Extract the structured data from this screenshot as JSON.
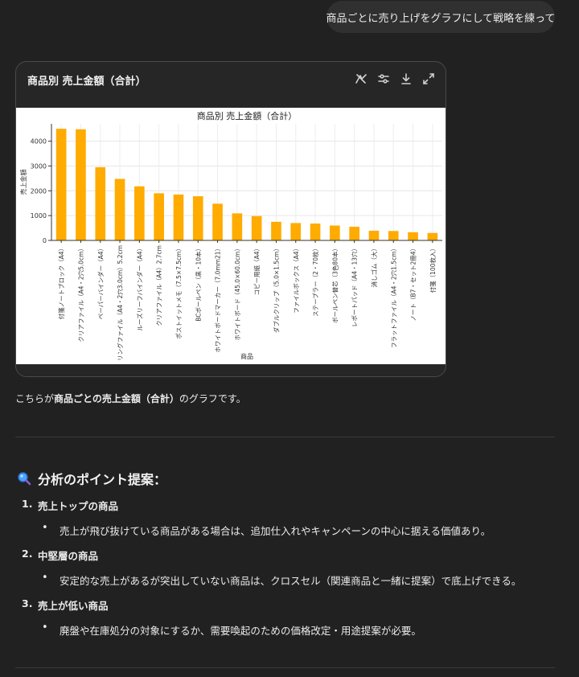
{
  "user_message": "商品ごとに売り上げをグラフにして戦略を練って",
  "card": {
    "title": "商品別 売上金額（合計）",
    "icons": [
      "switch-view-icon",
      "settings-sliders-icon",
      "download-icon",
      "expand-icon"
    ]
  },
  "chart_data": {
    "type": "bar",
    "title": "商品別 売上金額（合計）",
    "xlabel": "商品",
    "ylabel": "売上金額",
    "ylim": [
      0,
      4700
    ],
    "yticks": [
      0,
      1000,
      2000,
      3000,
      4000
    ],
    "grid": true,
    "bar_color": "#ffab00",
    "categories": [
      "付箋ノートブロック（A4）",
      "クリアファイル（A4・2穴5.0cm）",
      "ペーパーバインダー（A4）",
      "リングファイル（A4・2穴3.0cm）5.2cm",
      "ルーズリーフバインダー（A4）",
      "クリアファイル（A4）2.7cm",
      "ポストイットメモ（7.5×7.5cm）",
      "BCボールペン（黒・10本）",
      "ホワイトボードマーカー（7.0mm21）",
      "ホワイトボード（45.0×60.0cm）",
      "コピー用紙（A4）",
      "ダブルクリップ（5.0×1.5cm）",
      "ファイルボックス（A4）",
      "ステープラー（2・70枚）",
      "ボールペン替芯（3色80本）",
      "レポートパッド（A4・13穴）",
      "消しゴム（大）",
      "フラットファイル（A4・2穴1.5cm）",
      "ノート（B7・セット2冊4）",
      "付箋（100枚入）"
    ],
    "values": [
      4500,
      4480,
      2950,
      2480,
      2180,
      1900,
      1850,
      1780,
      1480,
      1090,
      980,
      750,
      700,
      680,
      600,
      550,
      390,
      380,
      330,
      300
    ]
  },
  "summary": {
    "prefix": "こちらが",
    "bold": "商品ごとの売上金額（合計）",
    "suffix": "のグラフです。"
  },
  "section": {
    "heading": "分析のポイント提案：",
    "items": [
      {
        "number": "1.",
        "title": "売上トップの商品",
        "bullet": "売上が飛び抜けている商品がある場合は、追加仕入れやキャンペーンの中心に据える価値あり。"
      },
      {
        "number": "2.",
        "title": "中堅層の商品",
        "bullet": "安定的な売上があるが突出していない商品は、クロスセル（関連商品と一緒に提案）で底上げできる。"
      },
      {
        "number": "3.",
        "title": "売上が低い商品",
        "bullet": "廃盤や在庫処分の対象にするか、需要喚起のための価格改定・用途提案が必要。"
      }
    ]
  }
}
